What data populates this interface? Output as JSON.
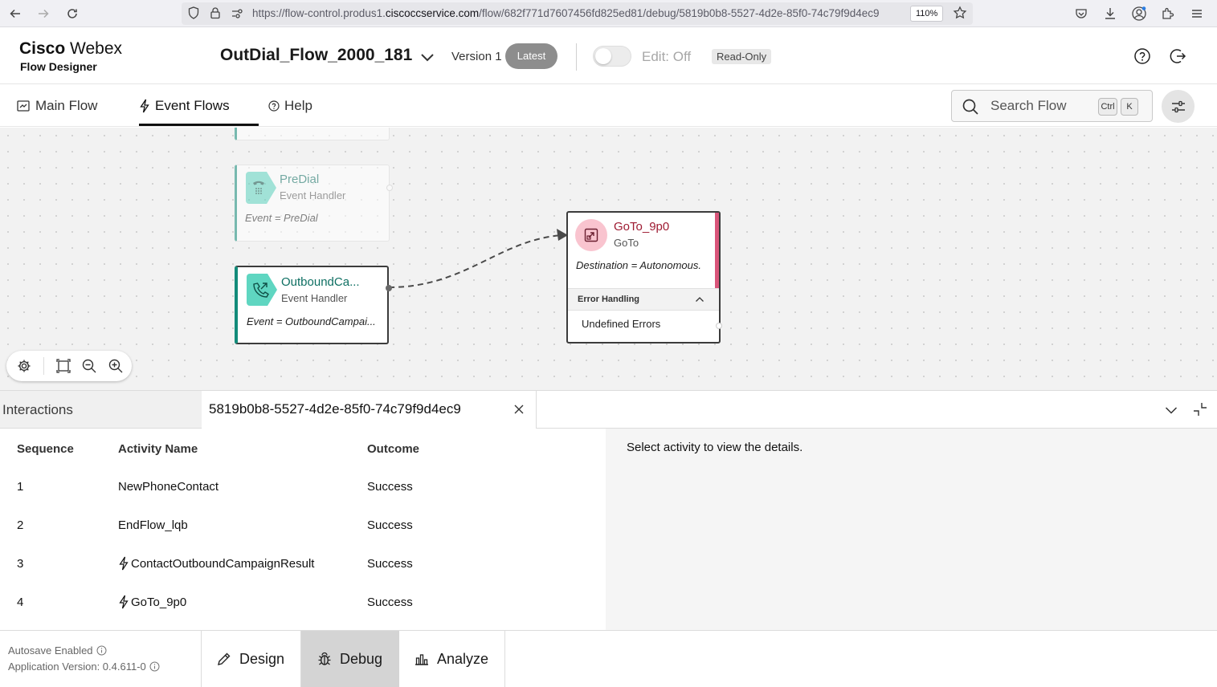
{
  "browser": {
    "url_prefix": "https://flow-control.produs1.",
    "url_domain": "ciscoccservice.com",
    "url_path": "/flow/682f771d7607456fd825ed81/debug/5819b0b8-5527-4d2e-85f0-74c79f9d4ec9",
    "zoom": "110%"
  },
  "header": {
    "brand_bold": "Cisco",
    "brand_light": "Webex",
    "brand_sub": "Flow Designer",
    "flow_name": "OutDial_Flow_2000_181",
    "version_label": "Version 1",
    "version_badge": "Latest",
    "edit_label": "Edit: Off",
    "readonly_badge": "Read-Only"
  },
  "tabs": [
    {
      "label": "Main Flow",
      "icon": "flow-icon"
    },
    {
      "label": "Event Flows",
      "icon": "lightning-icon"
    },
    {
      "label": "Help",
      "icon": "help-circle-icon"
    }
  ],
  "search": {
    "placeholder": "Search Flow",
    "key1": "Ctrl",
    "key2": "K"
  },
  "canvas": {
    "nodes": {
      "predial": {
        "title": "PreDial",
        "subtitle": "Event Handler",
        "expression": "Event = PreDial"
      },
      "outbound": {
        "title": "OutboundCa...",
        "subtitle": "Event Handler",
        "expression": "Event = OutboundCampai..."
      },
      "goto": {
        "title": "GoTo_9p0",
        "subtitle": "GoTo",
        "expression": "Destination = Autonomous.",
        "section_label": "Error Handling",
        "section_item": "Undefined Errors"
      }
    }
  },
  "debug": {
    "interactions_label": "Interactions",
    "session_id": "5819b0b8-5527-4d2e-85f0-74c79f9d4ec9",
    "columns": [
      "Sequence",
      "Activity Name",
      "Outcome"
    ],
    "rows": [
      {
        "seq": "1",
        "activity": "NewPhoneContact",
        "outcome": "Success",
        "event": false
      },
      {
        "seq": "2",
        "activity": "EndFlow_lqb",
        "outcome": "Success",
        "event": false
      },
      {
        "seq": "3",
        "activity": "ContactOutboundCampaignResult",
        "outcome": "Success",
        "event": true
      },
      {
        "seq": "4",
        "activity": "GoTo_9p0",
        "outcome": "Success",
        "event": true
      }
    ],
    "detail_placeholder": "Select activity to view the details."
  },
  "footer": {
    "autosave": "Autosave Enabled",
    "app_version": "Application Version: 0.4.611-0",
    "modes": [
      {
        "label": "Design",
        "icon": "pencil-icon",
        "active": false
      },
      {
        "label": "Debug",
        "icon": "bug-icon",
        "active": true
      },
      {
        "label": "Analyze",
        "icon": "bar-chart-icon",
        "active": false
      }
    ]
  },
  "colors": {
    "event_handler": "#5fd6c1",
    "event_border": "#138b7a",
    "goto_title": "#9e1b32",
    "goto_accent": "#d9557a",
    "goto_icon_bg": "#f9c4cf"
  }
}
